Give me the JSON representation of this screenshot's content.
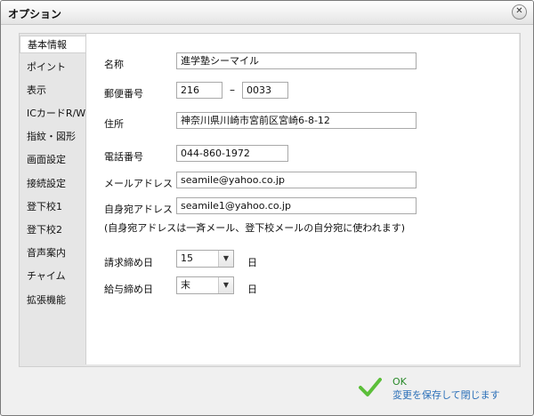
{
  "window": {
    "title": "オプション"
  },
  "sidebar": {
    "items": [
      {
        "label": "基本情報"
      },
      {
        "label": "ポイント"
      },
      {
        "label": "表示"
      },
      {
        "label": "ICカードR/W"
      },
      {
        "label": "指紋・図形"
      },
      {
        "label": "画面設定"
      },
      {
        "label": "接続設定"
      },
      {
        "label": "登下校1"
      },
      {
        "label": "登下校2"
      },
      {
        "label": "音声案内"
      },
      {
        "label": "チャイム"
      },
      {
        "label": "拡張機能"
      }
    ],
    "active_index": 0
  },
  "form": {
    "name": {
      "label": "名称",
      "value": "進学塾シーマイル"
    },
    "postal": {
      "label": "郵便番号",
      "value1": "216",
      "dash": "–",
      "value2": "0033"
    },
    "address": {
      "label": "住所",
      "value": "神奈川県川崎市宮前区宮崎6-8-12"
    },
    "phone": {
      "label": "電話番号",
      "value": "044-860-1972"
    },
    "mail": {
      "label": "メールアドレス",
      "value": "seamile@yahoo.co.jp"
    },
    "self_mail": {
      "label": "自身宛アドレス",
      "value": "seamile1@yahoo.co.jp"
    },
    "note": "(自身宛アドレスは一斉メール、登下校メールの自分宛に使われます)",
    "billing_close": {
      "label": "請求締め日",
      "value": "15",
      "unit": "日"
    },
    "salary_close": {
      "label": "給与締め日",
      "value": "末",
      "unit": "日"
    }
  },
  "ok": {
    "label": "OK",
    "sublabel": "変更を保存して閉じます"
  },
  "icons": {
    "close": "close-icon",
    "ok": "check-icon",
    "dropdown": "chevron-down-icon"
  },
  "colors": {
    "ok_check": "#5cbf3a",
    "ok_text": "#2a8a2a",
    "ok_sub": "#2a6fb8"
  }
}
